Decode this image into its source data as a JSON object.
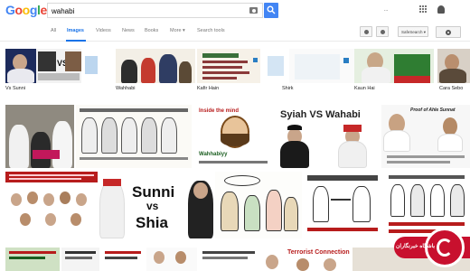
{
  "header": {
    "logo": "Google",
    "search_query": "wahabi",
    "username": "..."
  },
  "tabs": {
    "items": [
      "All",
      "Images",
      "Videos",
      "News",
      "Books",
      "More ▾",
      "Search tools"
    ],
    "active": "Images",
    "safesearch_label": "SafeSearch ▾"
  },
  "results": {
    "row1_captions": [
      "Vs Sunni",
      "Wahhabi",
      "Kafir Hain",
      "Shirk",
      "Kaun Hai",
      "Cara Sebo"
    ],
    "texts": {
      "syiah_vs_wahabi": "Syiah VS Wahabi",
      "sunni": "Sunni",
      "vs": "vs",
      "shia": "Shia",
      "inside_mind": "Inside the mind",
      "wahhabiyy": "Wahhabiyy",
      "proof_ahle_sunnat": "Proof of Ahle Sunnat",
      "terrorist_connection": "Terrorist Connection",
      "watermark": "باشگاه خبرنگاران",
      "vs_short": "VS"
    }
  },
  "colors": {
    "google_blue": "#4285f4",
    "google_red": "#ea4335",
    "google_yellow": "#fbbc05",
    "google_green": "#34a853",
    "active_tab": "#1a73e8",
    "watermark_red": "#c8102e"
  }
}
